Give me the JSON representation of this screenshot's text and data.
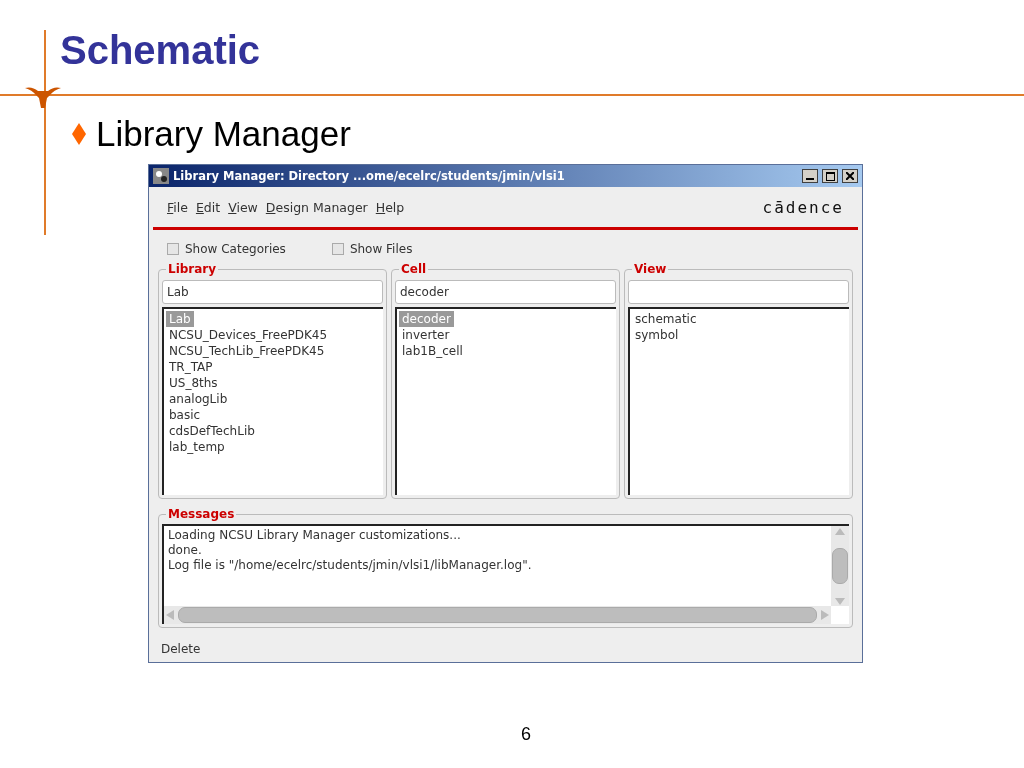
{
  "slide": {
    "title": "Schematic",
    "bullets": [
      "Library Manager"
    ],
    "page_number": "6"
  },
  "window": {
    "title": "Library Manager: Directory ...ome/ecelrc/students/jmin/vlsi1",
    "logo": "cādence",
    "menu": [
      "File",
      "Edit",
      "View",
      "Design Manager",
      "Help"
    ],
    "options": [
      {
        "label": "Show Categories",
        "checked": false
      },
      {
        "label": "Show Files",
        "checked": false
      }
    ],
    "columns": [
      {
        "heading": "Library",
        "value": "Lab",
        "items": [
          {
            "label": "Lab",
            "selected": true
          },
          {
            "label": "NCSU_Devices_FreePDK45",
            "selected": false
          },
          {
            "label": "NCSU_TechLib_FreePDK45",
            "selected": false
          },
          {
            "label": "TR_TAP",
            "selected": false
          },
          {
            "label": "US_8ths",
            "selected": false
          },
          {
            "label": "analogLib",
            "selected": false
          },
          {
            "label": "basic",
            "selected": false
          },
          {
            "label": "cdsDefTechLib",
            "selected": false
          },
          {
            "label": "lab_temp",
            "selected": false
          }
        ]
      },
      {
        "heading": "Cell",
        "value": "decoder",
        "items": [
          {
            "label": "decoder",
            "selected": true
          },
          {
            "label": "inverter",
            "selected": false
          },
          {
            "label": "lab1B_cell",
            "selected": false
          }
        ]
      },
      {
        "heading": "View",
        "items": [
          {
            "label": "schematic",
            "selected": false
          },
          {
            "label": "symbol",
            "selected": false
          }
        ]
      }
    ],
    "messages": {
      "heading": "Messages",
      "lines": [
        "Loading NCSU Library Manager customizations...",
        "done.",
        "Log file is \"/home/ecelrc/students/jmin/vlsi1/libManager.log\"."
      ]
    },
    "status_bar": "Delete"
  }
}
